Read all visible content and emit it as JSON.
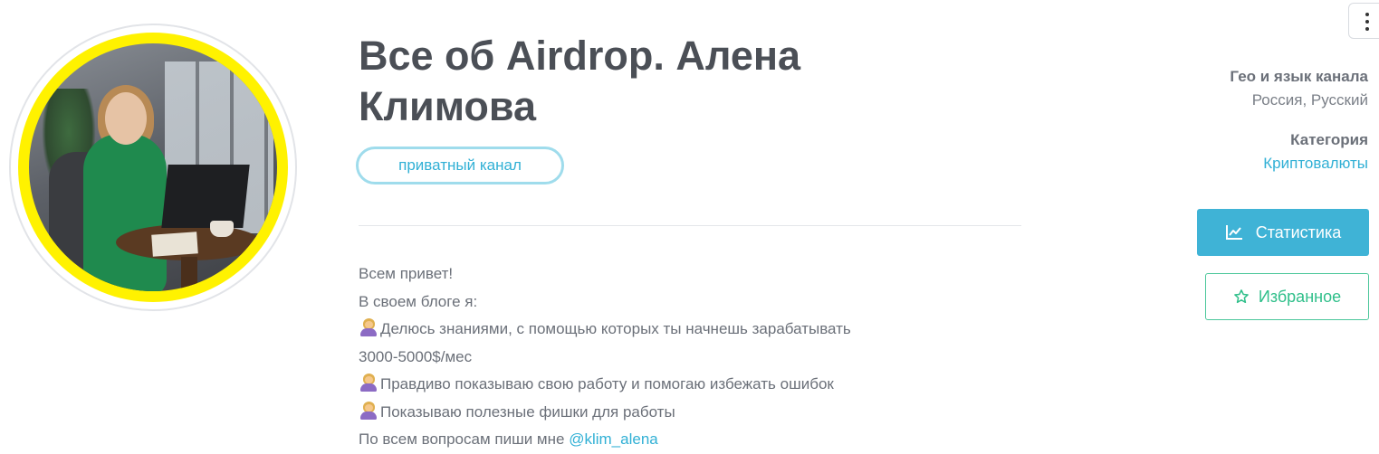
{
  "channel": {
    "title_line1": "Все об Airdrop. Алена",
    "title_line2": "Климова",
    "badge": "приватный канал"
  },
  "description": {
    "lines": [
      "Всем привет!",
      "В своем блоге я:",
      "Делюсь знаниями, с помощью которых ты начнешь зарабатывать",
      "3000-5000$/мес",
      "Правдиво показываю свою работу и помогаю избежать ошибок",
      "Показываю полезные фишки для работы",
      "По всем вопросам пиши мне "
    ],
    "contact_link": "@klim_alena",
    "emoji": "woman-tipping-hand-emoji"
  },
  "sidebar": {
    "geo_label": "Гео и язык канала",
    "geo_value": "Россия, Русский",
    "category_label": "Категория",
    "category_value": "Криптовалюты",
    "stats_button": "Статистика",
    "favorite_button": "Избранное"
  },
  "icons": {
    "menu": "kebab-menu-icon",
    "stats": "chart-line-icon",
    "favorite": "star-outline-icon"
  },
  "colors": {
    "accent_blue": "#3fb3d6",
    "accent_green": "#2fbf8a",
    "avatar_ring": "#fff200",
    "title": "#4b4f56"
  }
}
